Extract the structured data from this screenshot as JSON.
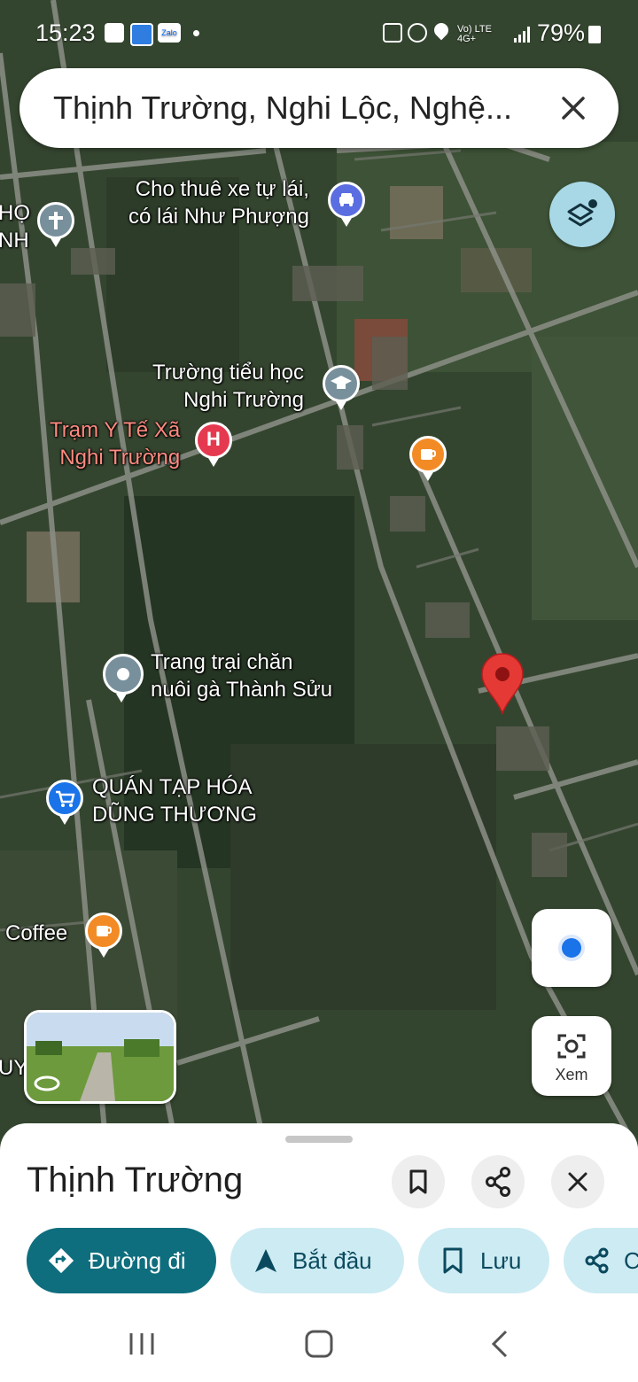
{
  "status_bar": {
    "time": "15:23",
    "network": "Vo) LTE 4G+",
    "battery": "79%"
  },
  "search": {
    "query": "Thịnh Trường, Nghi Lộc, Nghệ..."
  },
  "map_labels": {
    "car_rental": [
      "Cho thuê xe tự lái,",
      "có lái Như Phượng"
    ],
    "left_edge_top": [
      "HỌ",
      "NH"
    ],
    "school": [
      "Trường tiểu học",
      "Nghi Trường"
    ],
    "clinic": [
      "Trạm Y Tế Xã",
      "Nghi Trường"
    ],
    "farm": [
      "Trang trại chăn",
      "nuôi gà Thành Sửu"
    ],
    "store": [
      "QUÁN TẠP HÓA",
      "DŨNG THƯƠNG"
    ],
    "coffee": "Coffee",
    "left_edge_bottom": "UY"
  },
  "buttons": {
    "xem_label": "Xem"
  },
  "sheet": {
    "title": "Thịnh Trường",
    "chips": {
      "directions": "Đường đi",
      "start": "Bắt đầu",
      "save": "Lưu",
      "share": "C"
    }
  },
  "colors": {
    "primary_chip": "#0e6e7e",
    "secondary_chip": "#cdebf3",
    "pin_red": "#e53935",
    "hospital_red": "#e53950",
    "cafe_orange": "#f28b25",
    "store_blue": "#1a73e8"
  }
}
